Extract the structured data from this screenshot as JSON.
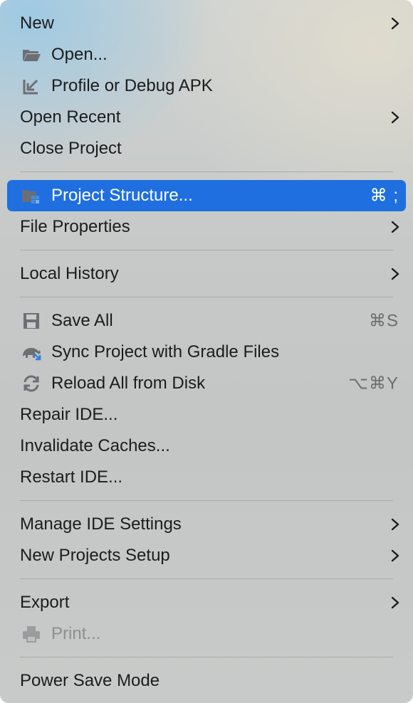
{
  "menu": {
    "items": {
      "new": {
        "label": "New"
      },
      "open": {
        "label": "Open..."
      },
      "profile_debug_apk": {
        "label": "Profile or Debug APK"
      },
      "open_recent": {
        "label": "Open Recent"
      },
      "close_project": {
        "label": "Close Project"
      },
      "project_structure": {
        "label": "Project Structure...",
        "shortcut": "⌘ ;"
      },
      "file_properties": {
        "label": "File Properties"
      },
      "local_history": {
        "label": "Local History"
      },
      "save_all": {
        "label": "Save All",
        "shortcut": "⌘S"
      },
      "sync_gradle": {
        "label": "Sync Project with Gradle Files"
      },
      "reload_disk": {
        "label": "Reload All from Disk",
        "shortcut": "⌥⌘Y"
      },
      "repair_ide": {
        "label": "Repair IDE..."
      },
      "invalidate_caches": {
        "label": "Invalidate Caches..."
      },
      "restart_ide": {
        "label": "Restart IDE..."
      },
      "manage_ide_settings": {
        "label": "Manage IDE Settings"
      },
      "new_projects_setup": {
        "label": "New Projects Setup"
      },
      "export": {
        "label": "Export"
      },
      "print": {
        "label": "Print..."
      },
      "power_save_mode": {
        "label": "Power Save Mode"
      }
    }
  },
  "colors": {
    "selection": "#1f6fe0",
    "text": "#1c1c1e",
    "disabled_text": "#8c8e90",
    "shortcut_text": "#6b6d70"
  },
  "icons": {
    "open": "folder-open-icon",
    "profile_debug_apk": "arrow-into-corner-icon",
    "project_structure": "project-structure-icon",
    "save_all": "floppy-disk-icon",
    "sync_gradle": "gradle-sync-icon",
    "reload_disk": "reload-icon",
    "print": "printer-icon",
    "submenu": "chevron-right-icon"
  }
}
